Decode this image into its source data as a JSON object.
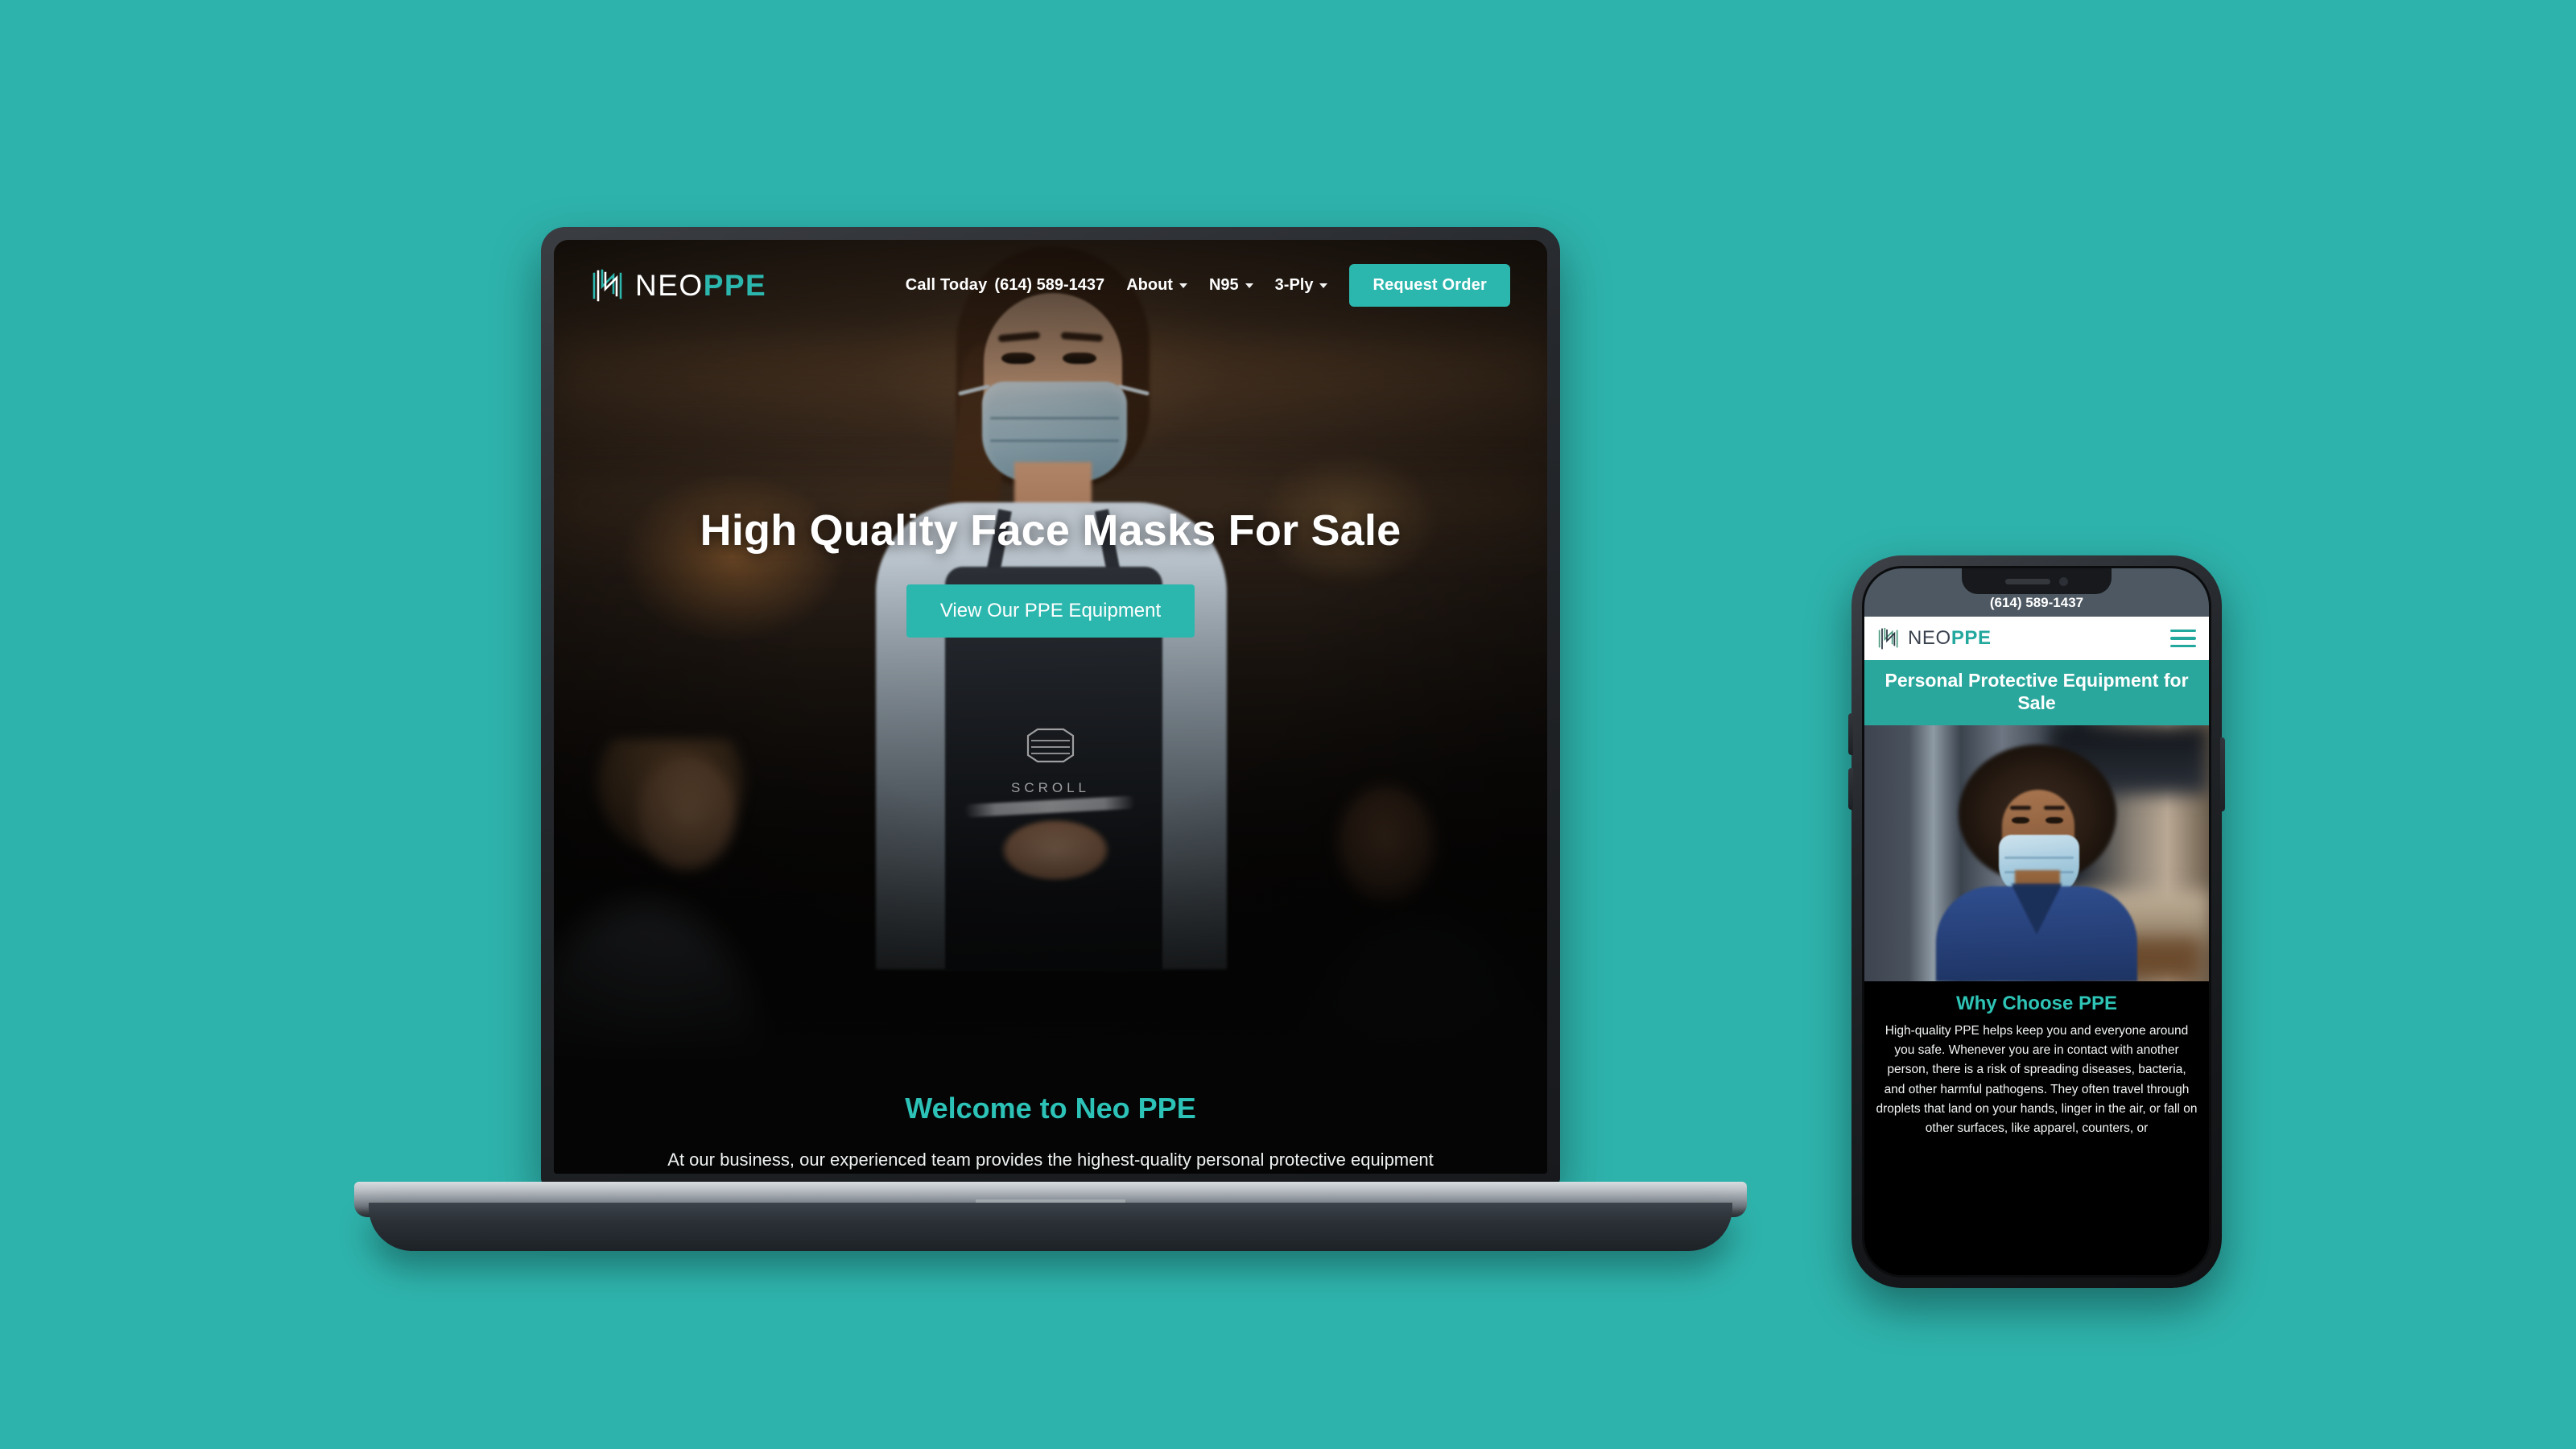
{
  "theme": {
    "background": "#2eb3ac",
    "accent_teal": "#2cb7ae",
    "heading_teal": "#2ec4b6",
    "dark": "#050505"
  },
  "desktop": {
    "logo": {
      "icon": "neo-monogram-icon",
      "part1": "NEO",
      "part2": "PPE"
    },
    "nav": {
      "call_label": "Call Today",
      "phone": "(614) 589-1437",
      "items": [
        {
          "label": "About",
          "has_dropdown": true
        },
        {
          "label": "N95",
          "has_dropdown": true
        },
        {
          "label": "3-Ply",
          "has_dropdown": true
        }
      ],
      "cta_label": "Request Order"
    },
    "hero": {
      "heading": "High Quality Face Masks For Sale",
      "cta_label": "View Our PPE Equipment",
      "scroll_label": "SCROLL",
      "scroll_icon": "face-mask-icon"
    },
    "welcome": {
      "heading": "Welcome to Neo PPE",
      "body": "At our business, our experienced team provides the highest-quality personal protective equipment"
    }
  },
  "mobile": {
    "topbar_phone": "(614) 589-1437",
    "logo": {
      "icon": "neo-monogram-icon",
      "part1": "NEO",
      "part2": "PPE"
    },
    "menu_icon": "hamburger-menu-icon",
    "banner": "Personal Protective Equipment for Sale",
    "section": {
      "heading": "Why Choose PPE",
      "body": "High-quality PPE helps keep you and everyone around you safe. Whenever you are in contact with another person, there is a risk of spreading diseases, bacteria, and other harmful pathogens. They often travel through droplets that land on your hands, linger in the air, or fall on other surfaces, like apparel, counters, or"
    }
  }
}
